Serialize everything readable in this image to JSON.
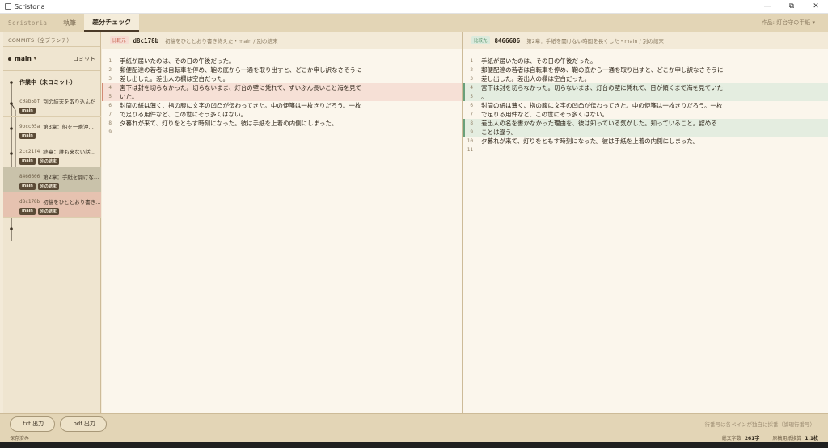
{
  "window": {
    "title": "Scristoria",
    "minimize": "—",
    "maximize": "⧉",
    "close": "✕"
  },
  "tabs": [
    {
      "label": "Scristoria"
    },
    {
      "label": "執筆"
    },
    {
      "label": "差分チェック"
    }
  ],
  "work_select": "作品: 灯台守の手紙 ▾",
  "sidebar": {
    "header": "COMMITS（全ブランチ）",
    "branch": "main",
    "commit_button": "コミット",
    "wip": "作業中（未コミット）",
    "commits": [
      {
        "hash": "c0ab5bf",
        "msg": "別の結末を取り込んだ",
        "badges": [
          "main"
        ]
      },
      {
        "hash": "9bcc05a",
        "msg": "第3章：船を一晩沖…",
        "badges": [
          "main"
        ]
      },
      {
        "hash": "2cc21f4",
        "msg": "終章：誰も来ない話…",
        "badges": [
          "main",
          "別の結末"
        ]
      },
      {
        "hash": "8466606",
        "msg": "第2章：手紙を開けな…",
        "badges": [
          "main",
          "別の結末"
        ]
      },
      {
        "hash": "d8c178b",
        "msg": "初稿をひととおり書き…",
        "badges": [
          "main",
          "別の結末"
        ]
      }
    ]
  },
  "left_pane": {
    "side_label": "比較元",
    "hash": "d8c178b",
    "msg": "初稿をひととおり書き終えた・main / 別の結末",
    "lines": [
      {
        "n": "1",
        "text": "手紙が届いたのは、その日の午後だった。",
        "type": ""
      },
      {
        "n": "2",
        "text": "郵便配達の若者は自転車を停め、鞄の底から一通を取り出すと、どこか申し訳なさそうに",
        "type": ""
      },
      {
        "n": "3",
        "text": "差し出した。差出人の欄は空白だった。",
        "type": ""
      },
      {
        "n": "4",
        "text": "宮下は封を切らなかった。切らないまま、灯台の壁に凭れて、ずいぶん長いこと海を見て",
        "type": "del"
      },
      {
        "n": "5",
        "text": "いた。",
        "type": "del"
      },
      {
        "n": "6",
        "text": "封筒の紙は薄く、指の腹に文字の凹凸が伝わってきた。中の便箋は一枚きりだろう。一枚",
        "type": ""
      },
      {
        "n": "7",
        "text": "で足りる用件など、この世にそう多くはない。",
        "type": ""
      },
      {
        "n": "8",
        "text": "夕暮れが来て、灯りをともす時刻になった。彼は手紙を上着の内側にしまった。",
        "type": ""
      },
      {
        "n": "9",
        "text": "",
        "type": ""
      }
    ]
  },
  "right_pane": {
    "side_label": "比較先",
    "hash": "8466606",
    "msg": "第2章：手紙を開けない時間を長くした・main / 別の結末",
    "lines": [
      {
        "n": "1",
        "text": "手紙が届いたのは、その日の午後だった。",
        "type": ""
      },
      {
        "n": "2",
        "text": "郵便配達の若者は自転車を停め、鞄の底から一通を取り出すと、どこか申し訳なさそうに",
        "type": ""
      },
      {
        "n": "3",
        "text": "差し出した。差出人の欄は空白だった。",
        "type": ""
      },
      {
        "n": "4",
        "text": "宮下は封を切らなかった。切らないまま、灯台の壁に凭れて、日が傾くまで海を見ていた",
        "type": "add"
      },
      {
        "n": "5",
        "text": "。",
        "type": "add"
      },
      {
        "n": "6",
        "text": "封筒の紙は薄く、指の腹に文字の凹凸が伝わってきた。中の便箋は一枚きりだろう。一枚",
        "type": ""
      },
      {
        "n": "7",
        "text": "で足りる用件など、この世にそう多くはない。",
        "type": ""
      },
      {
        "n": "8",
        "text": "差出人の名を書かなかった理由を、彼は知っている気がした。知っていること。認める",
        "type": "add"
      },
      {
        "n": "9",
        "text": "ことは違う。",
        "type": "add"
      },
      {
        "n": "10",
        "text": "夕暮れが来て、灯りをともす時刻になった。彼は手紙を上着の内側にしまった。",
        "type": ""
      },
      {
        "n": "11",
        "text": "",
        "type": ""
      }
    ]
  },
  "footer": {
    "txt_button": ".txt 出力",
    "pdf_button": ".pdf 出力",
    "note": "行番号は各ペインが独自に採番（論理行番号）"
  },
  "status": {
    "saved": "保存済み",
    "chars_label": "総文字数",
    "chars_value": "261字",
    "pages_label": "原稿用紙換算",
    "pages_value": "1.1枚"
  }
}
